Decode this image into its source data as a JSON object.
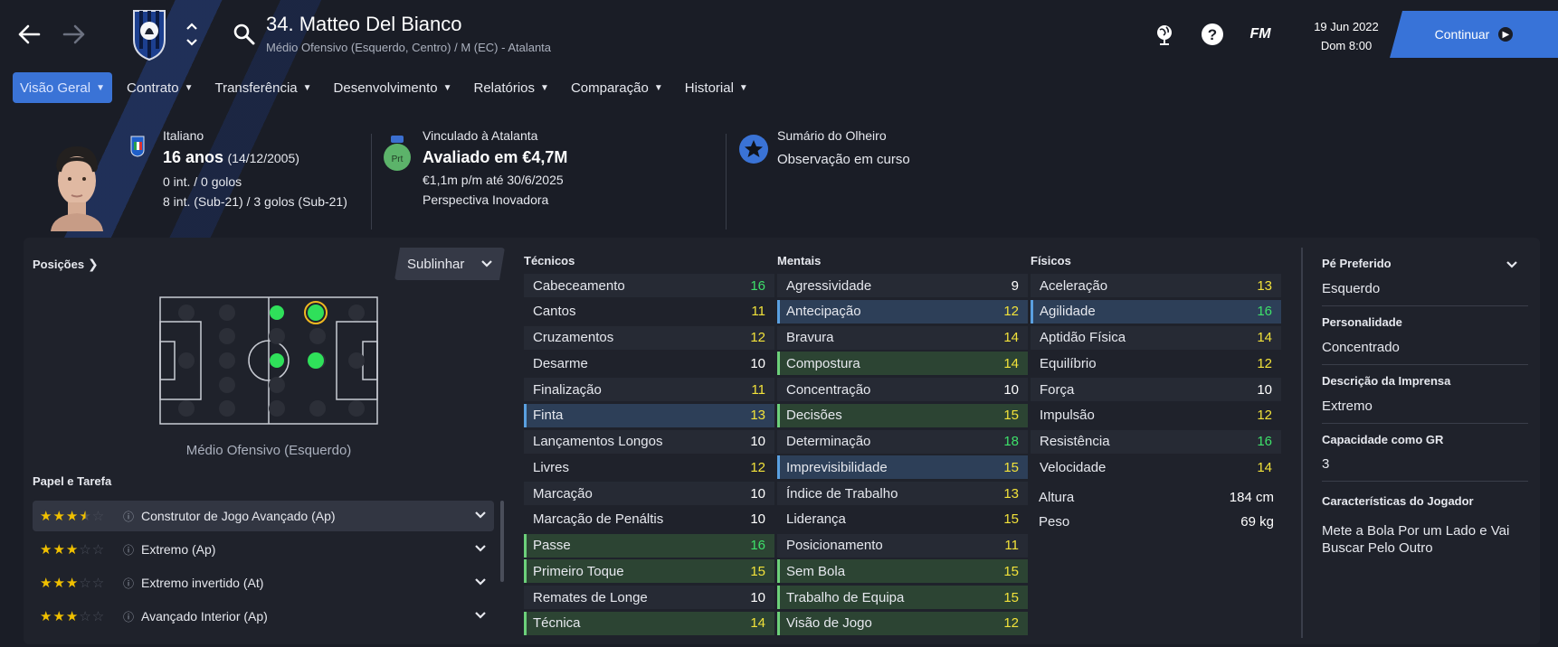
{
  "header": {
    "player_name": "34. Matteo Del Bianco",
    "player_sub": "Médio Ofensivo (Esquerdo, Centro) / M (EC) - Atalanta",
    "crest_year": "1907",
    "crest_name": "ATALANTA",
    "date": "19 Jun 2022",
    "time": "Dom 8:00",
    "continue_label": "Continuar",
    "fm_label": "FM"
  },
  "tabs": [
    {
      "label": "Visão Geral",
      "active": true
    },
    {
      "label": "Contrato"
    },
    {
      "label": "Transferência"
    },
    {
      "label": "Desenvolvimento"
    },
    {
      "label": "Relatórios"
    },
    {
      "label": "Comparação"
    },
    {
      "label": "Historial"
    }
  ],
  "bio": {
    "nationality": "Italiano",
    "age": "16 anos",
    "birth": "(14/12/2005)",
    "caps": "0 int. / 0 golos",
    "u21": "8 int. (Sub-21) / 3 golos (Sub-21)"
  },
  "contract": {
    "badge": "Prt",
    "club_line": "Vinculado à Atalanta",
    "value": "Avaliado em €4,7M",
    "wage": "€1,1m p/m até 30/6/2025",
    "prospect": "Perspectiva Inovadora"
  },
  "scout": {
    "title": "Sumário do Olheiro",
    "status": "Observação em curso"
  },
  "positions": {
    "title": "Posições",
    "highlight_button": "Sublinhar",
    "pitch_label": "Médio Ofensivo (Esquerdo)"
  },
  "roles": {
    "title": "Papel e Tarefa",
    "items": [
      {
        "name": "Construtor de Jogo Avançado (Ap)",
        "stars": 3.5
      },
      {
        "name": "Extremo (Ap)",
        "stars": 3
      },
      {
        "name": "Extremo invertido (At)",
        "stars": 3
      },
      {
        "name": "Avançado Interior (Ap)",
        "stars": 3
      }
    ]
  },
  "technical": {
    "title": "Técnicos",
    "rows": [
      {
        "name": "Cabeceamento",
        "value": "16"
      },
      {
        "name": "Cantos",
        "value": "11"
      },
      {
        "name": "Cruzamentos",
        "value": "12"
      },
      {
        "name": "Desarme",
        "value": "10"
      },
      {
        "name": "Finalização",
        "value": "11"
      },
      {
        "name": "Finta",
        "value": "13"
      },
      {
        "name": "Lançamentos Longos",
        "value": "10"
      },
      {
        "name": "Livres",
        "value": "12"
      },
      {
        "name": "Marcação",
        "value": "10"
      },
      {
        "name": "Marcação de Penáltis",
        "value": "10"
      },
      {
        "name": "Passe",
        "value": "16"
      },
      {
        "name": "Primeiro Toque",
        "value": "15"
      },
      {
        "name": "Remates de Longe",
        "value": "10"
      },
      {
        "name": "Técnica",
        "value": "14"
      }
    ]
  },
  "mental": {
    "title": "Mentais",
    "rows": [
      {
        "name": "Agressividade",
        "value": "9"
      },
      {
        "name": "Antecipação",
        "value": "12"
      },
      {
        "name": "Bravura",
        "value": "14"
      },
      {
        "name": "Compostura",
        "value": "14"
      },
      {
        "name": "Concentração",
        "value": "10"
      },
      {
        "name": "Decisões",
        "value": "15"
      },
      {
        "name": "Determinação",
        "value": "18"
      },
      {
        "name": "Imprevisibilidade",
        "value": "15"
      },
      {
        "name": "Índice de Trabalho",
        "value": "13"
      },
      {
        "name": "Liderança",
        "value": "15"
      },
      {
        "name": "Posicionamento",
        "value": "11"
      },
      {
        "name": "Sem Bola",
        "value": "15"
      },
      {
        "name": "Trabalho de Equipa",
        "value": "15"
      },
      {
        "name": "Visão de Jogo",
        "value": "12"
      }
    ]
  },
  "physical": {
    "title": "Físicos",
    "rows": [
      {
        "name": "Aceleração",
        "value": "13"
      },
      {
        "name": "Agilidade",
        "value": "16"
      },
      {
        "name": "Aptidão Física",
        "value": "14"
      },
      {
        "name": "Equilíbrio",
        "value": "12"
      },
      {
        "name": "Força",
        "value": "10"
      },
      {
        "name": "Impulsão",
        "value": "12"
      },
      {
        "name": "Resistência",
        "value": "16"
      },
      {
        "name": "Velocidade",
        "value": "14"
      }
    ],
    "height_label": "Altura",
    "height": "184 cm",
    "weight_label": "Peso",
    "weight": "69 kg"
  },
  "side": {
    "foot_label": "Pé Preferido",
    "foot": "Esquerdo",
    "personality_label": "Personalidade",
    "personality": "Concentrado",
    "media_label": "Descrição da Imprensa",
    "media": "Extremo",
    "gk_label": "Capacidade como GR",
    "gk": "3",
    "traits_label": "Características do Jogador",
    "traits": "Mete a Bola Por um Lado e Vai Buscar Pelo Outro"
  },
  "colors": {
    "accent": "#3a73d6",
    "green": "#3ee06a",
    "yellow": "#f2e23a",
    "panel": "#1f222b"
  }
}
